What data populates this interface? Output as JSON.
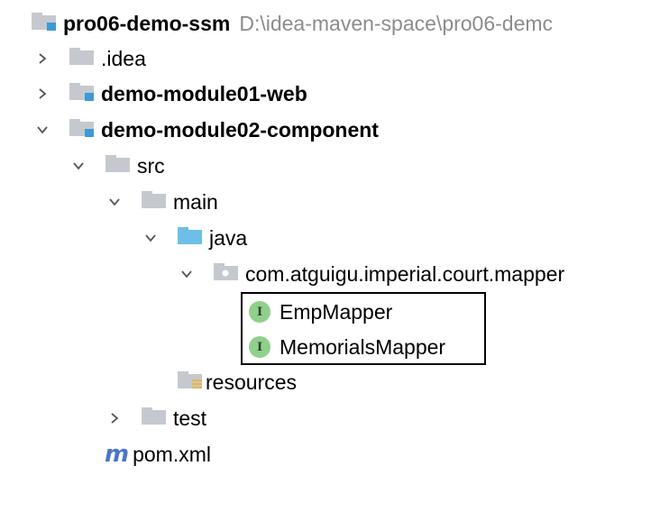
{
  "project": {
    "name": "pro06-demo-ssm",
    "path": "D:\\idea-maven-space\\pro06-demc"
  },
  "nodes": {
    "idea": ".idea",
    "web": "demo-module01-web",
    "component": "demo-module02-component",
    "src": "src",
    "main": "main",
    "java": "java",
    "pkg": "com.atguigu.imperial.court.mapper",
    "emp": "EmpMapper",
    "memorials": "MemorialsMapper",
    "resources": "resources",
    "test": "test",
    "pom": "pom.xml"
  },
  "icons": {
    "interface_badge": "I",
    "maven_glyph": "m"
  },
  "colors": {
    "folder": "#c5c9cf",
    "module_badge": "#3d9ad6",
    "source_folder": "#6dbfe8",
    "interface": "#8fd08a",
    "resource_marker": "#e8b74b",
    "maven": "#4a76c8",
    "path_text": "#8c8c8c"
  }
}
